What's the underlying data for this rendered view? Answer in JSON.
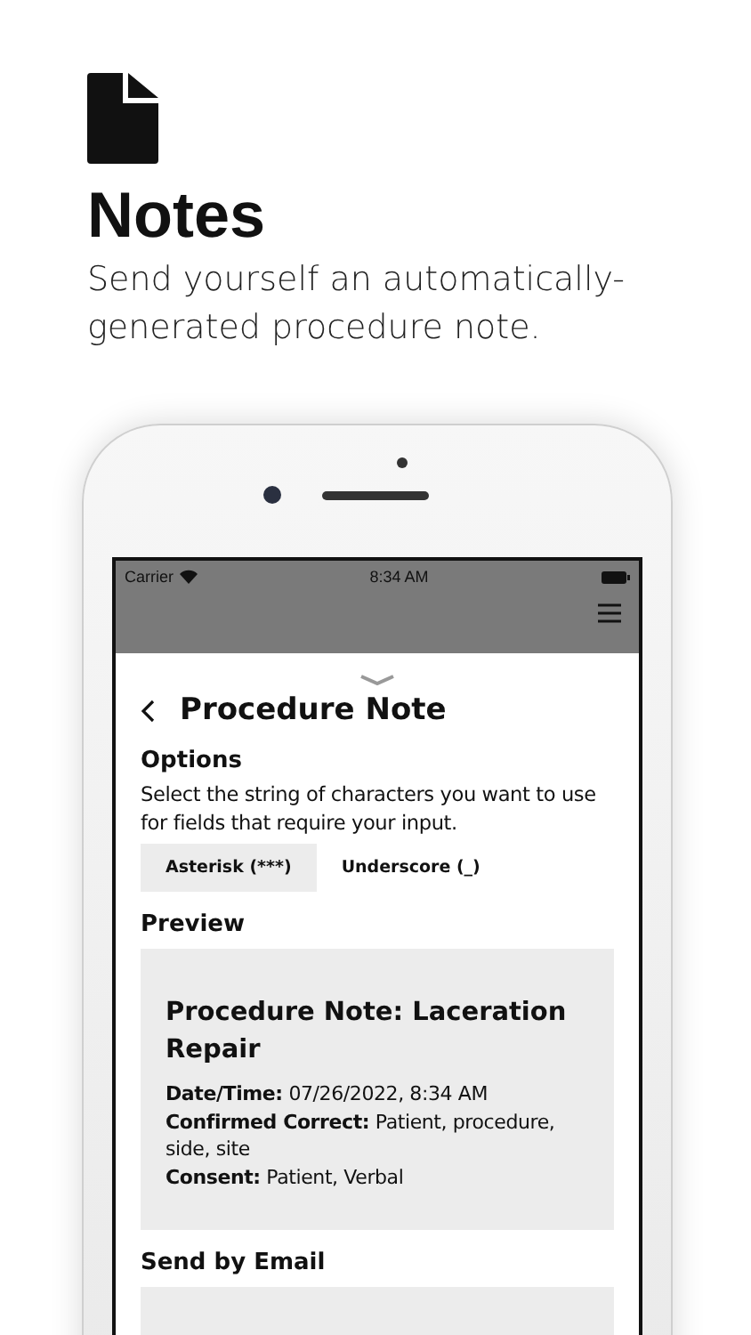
{
  "header": {
    "title": "Notes",
    "subtitle": "Send yourself an automatically-generated procedure note."
  },
  "status_bar": {
    "carrier": "Carrier",
    "time": "8:34 AM"
  },
  "screen": {
    "title": "Procedure Note",
    "options": {
      "heading": "Options",
      "description": "Select the string of characters you want to use for fields that require your input.",
      "choices": [
        {
          "label": "Asterisk (***)",
          "selected": true
        },
        {
          "label": "Underscore (_)",
          "selected": false
        }
      ]
    },
    "preview": {
      "heading": "Preview",
      "note_title": "Procedure Note: Laceration Repair",
      "lines": [
        {
          "label": "Date/Time:",
          "value": "07/26/2022, 8:34 AM"
        },
        {
          "label": "Confirmed Correct:",
          "value": "Patient, procedure, side, site"
        },
        {
          "label": "Consent:",
          "value": "Patient, Verbal"
        }
      ]
    },
    "email": {
      "heading": "Send by Email"
    }
  }
}
